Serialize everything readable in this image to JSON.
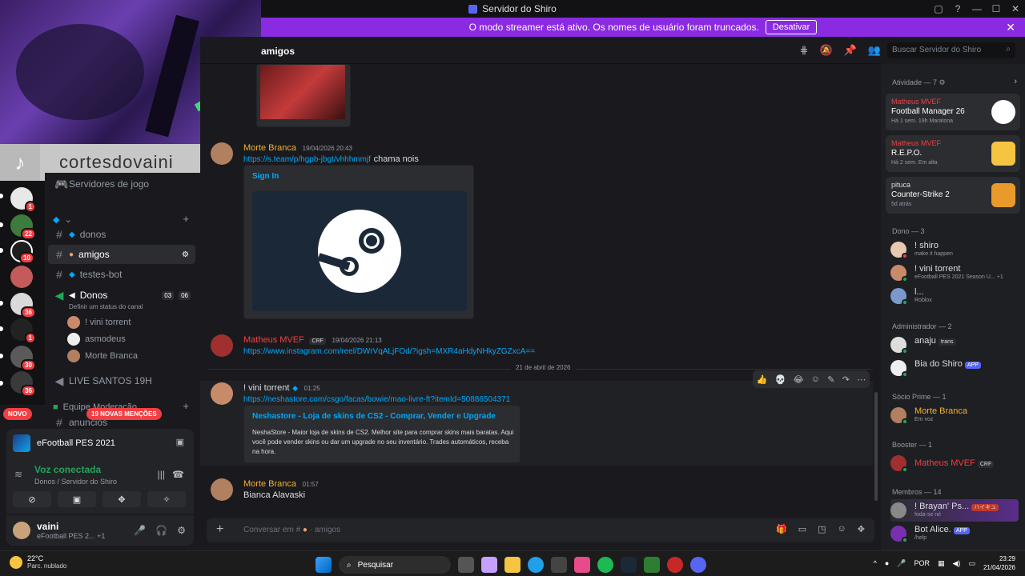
{
  "window": {
    "title": "Servidor do Shiro"
  },
  "banner": {
    "text": "O modo streamer está ativo. Os nomes de usuário foram truncados.",
    "button": "Desativar"
  },
  "overlay": {
    "tiktok_name": "cortesdovaini"
  },
  "servers": {
    "badges": [
      "1",
      "22",
      "10",
      "36",
      "1",
      "30",
      "36"
    ]
  },
  "channels": {
    "game_servers": "Servidores de jogo",
    "items": [
      {
        "name": "donos"
      },
      {
        "name": "amigos"
      },
      {
        "name": "testes-bot"
      }
    ],
    "voice": {
      "name": "Donos",
      "status": "Definir um status do canal",
      "count_a": "03",
      "count_b": "06",
      "users": [
        "! vini torrent",
        "asmodeus",
        "Morte Branca"
      ]
    },
    "live": "LIVE SANTOS 19H",
    "team_category": "Equipe Moderação",
    "anuncios": "anuncios",
    "novo": "NOVO",
    "mentions": "19 NOVAS MENÇÕES"
  },
  "activity": {
    "game": "eFootball PES 2021"
  },
  "voice_panel": {
    "status": "Voz conectada",
    "location": "Donos / Servidor do Shiro"
  },
  "user": {
    "name": "vaini",
    "activity": "eFootball PES 2...",
    "extra": "+1"
  },
  "header": {
    "channel": "amigos",
    "search_placeholder": "Buscar Servidor do Shiro"
  },
  "messages": [
    {
      "author": "Morte Branca",
      "time": "19/04/2026 20:43",
      "link": "https://s.team/p/hgpb-jbgt/vhhhmmjf",
      "text": "chama nois",
      "embed_title": "Sign In"
    },
    {
      "author": "Matheus MVEF",
      "tag": "CRF",
      "time": "19/04/2026 21:13",
      "link": "https://www.instagram.com/reel/DWrVqALjFOd/?igsh=MXR4aHdyNHkyZGZxcA=="
    },
    {
      "author": "! vini torrent",
      "time": "01:25",
      "link": "https://neshastore.com/csgo/facas/bowie/mao-livre-ft?itemId=50886504371",
      "embed_title": "Neshastore - Loja de skins de CS2 - Comprar, Vender e Upgrade",
      "embed_desc": "NeshaStore - Maior loja de skins de CS2. Melhor site para comprar skins mais baratas. Aqui você pode vender skins ou dar um upgrade no seu inventário. Trades automáticos, receba na hora."
    },
    {
      "author": "Morte Branca",
      "time": "01:57",
      "text": "Bianca Alavaski"
    }
  ],
  "date_divider": "21 de abril de 2026",
  "composer": {
    "placeholder": "Conversar em #",
    "channel": "amigos"
  },
  "members": {
    "activity_title": "Atividade — 7",
    "cards": [
      {
        "user": "Matheus MVEF",
        "game": "Football Manager 26",
        "meta": "Há 1 sem.   19h Maratona"
      },
      {
        "user": "Matheus MVEF",
        "game": "R.E.P.O.",
        "meta": "Há 2 sem.   Em alta"
      },
      {
        "user": "pituca",
        "game": "Counter-Strike 2",
        "meta": "5d atrás"
      }
    ],
    "dono_title": "Dono — 3",
    "donos": [
      {
        "name": "! shiro",
        "sub": "make it happen"
      },
      {
        "name": "! vini torrent",
        "sub": "eFootball PES 2021 Season U...",
        "extra": "+1"
      },
      {
        "name": "l...",
        "sub": "Roblox"
      }
    ],
    "admin_title": "Administrador — 2",
    "admins": [
      {
        "name": "anaju",
        "tag": "trans"
      },
      {
        "name": "Bia do Shiro",
        "tag": "APP"
      }
    ],
    "socio_title": "Sócio Prime — 1",
    "socios": [
      {
        "name": "Morte Branca",
        "sub": "Em voz"
      }
    ],
    "booster_title": "Booster — 1",
    "boosters": [
      {
        "name": "Matheus MVEF",
        "tag": "CRF"
      }
    ],
    "membros_title": "Membros — 14",
    "membros": [
      {
        "name": "! Brayan' Ps...",
        "tag": "ハイキュ",
        "sub": "foda-se né"
      },
      {
        "name": "Bot Alice.",
        "tag": "APP",
        "sub": "/help"
      }
    ]
  },
  "taskbar": {
    "temp": "22°C",
    "weather": "Parc. nublado",
    "search": "Pesquisar",
    "lang": "POR",
    "time": "23:29",
    "date": "21/04/2026"
  },
  "colors": {
    "accent": "#5865f2",
    "banner": "#8a2be2",
    "online": "#23a55a",
    "link": "#00a8fc",
    "mention": "#f23f43"
  }
}
